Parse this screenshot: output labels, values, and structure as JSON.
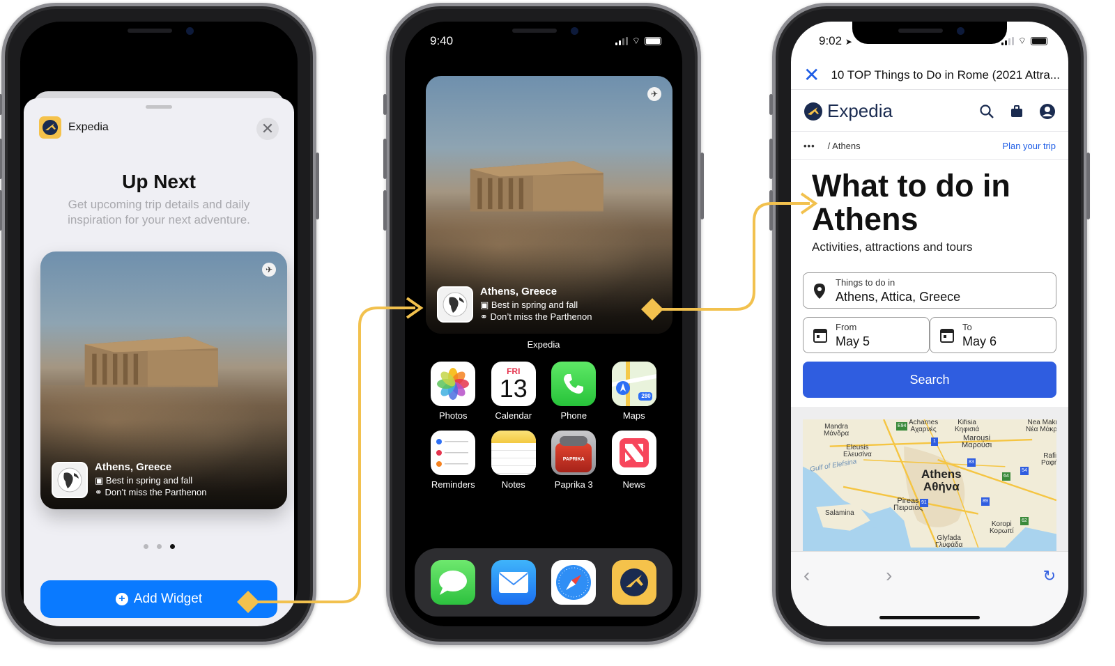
{
  "phone1": {
    "app_name": "Expedia",
    "widget_title": "Up Next",
    "widget_description": "Get upcoming trip details and daily inspiration for your next adventure.",
    "card": {
      "city": "Athens, Greece",
      "line1": "Best in spring and fall",
      "line2": "Don’t miss the Parthenon"
    },
    "page_dots": 3,
    "active_dot": 3,
    "add_widget_label": "Add Widget"
  },
  "phone2": {
    "time": "9:40",
    "card": {
      "city": "Athens, Greece",
      "line1": "Best in spring and fall",
      "line2": "Don’t miss the Parthenon"
    },
    "widget_label": "Expedia",
    "apps": [
      {
        "name": "Photos",
        "icon": "photos-icon"
      },
      {
        "name": "Calendar",
        "icon": "calendar-icon",
        "day": "FRI",
        "date": "13"
      },
      {
        "name": "Phone",
        "icon": "phone-icon"
      },
      {
        "name": "Maps",
        "icon": "maps-icon",
        "badge": "280"
      },
      {
        "name": "Reminders",
        "icon": "reminders-icon"
      },
      {
        "name": "Notes",
        "icon": "notes-icon"
      },
      {
        "name": "Paprika 3",
        "icon": "paprika-icon",
        "badge": "PAPRIKA"
      },
      {
        "name": "News",
        "icon": "news-icon"
      }
    ],
    "dock": [
      "messages-icon",
      "mail-icon",
      "safari-icon",
      "expedia-icon"
    ]
  },
  "phone3": {
    "time": "9:02",
    "page_title": "10 TOP Things to Do in Rome (2021 Attra...",
    "brand": "Expedia",
    "breadcrumb_more": "•••",
    "breadcrumb": "/ Athens",
    "plan_link": "Plan your trip",
    "heading": "What to do in Athens",
    "subheading": "Activities, attractions and tours",
    "destination": {
      "label": "Things to do in",
      "value": "Athens, Attica, Greece"
    },
    "from": {
      "label": "From",
      "value": "May 5"
    },
    "to": {
      "label": "To",
      "value": "May 6"
    },
    "search_label": "Search",
    "map_labels": {
      "mandra": "Mandra\nΜάνδρα",
      "eleusis": "Eleusis\nΕλευσίνα",
      "gulf": "Gulf of Elefsina",
      "acharnes": "Acharnes\nΑχαρνές",
      "kifisia": "Kifisia\nΚηφισιά",
      "nea_makri": "Nea Makri\nΝέα Μάκρη",
      "marousi": "Marousi\nΜαρούσι",
      "athens": "Athens\nΑθήνα",
      "rafina": "Rafina\nΡαφήνα",
      "pireas": "Pireas\nΠειραιάς",
      "salamina": "Salamina",
      "koropi": "Koropi\nΚορωπί",
      "glyfada": "Glyfada\nΓλυφάδα",
      "road_e94": "E94",
      "road_1": "1",
      "road_83": "83",
      "road_54": "54",
      "road_64": "64",
      "road_91": "91",
      "road_89": "89",
      "road_62": "62"
    }
  },
  "colors": {
    "accent_yellow": "#F2C14E",
    "ios_blue": "#0A7AFF",
    "expedia_blue": "#2F5DE0",
    "expedia_navy": "#1A2B50"
  }
}
